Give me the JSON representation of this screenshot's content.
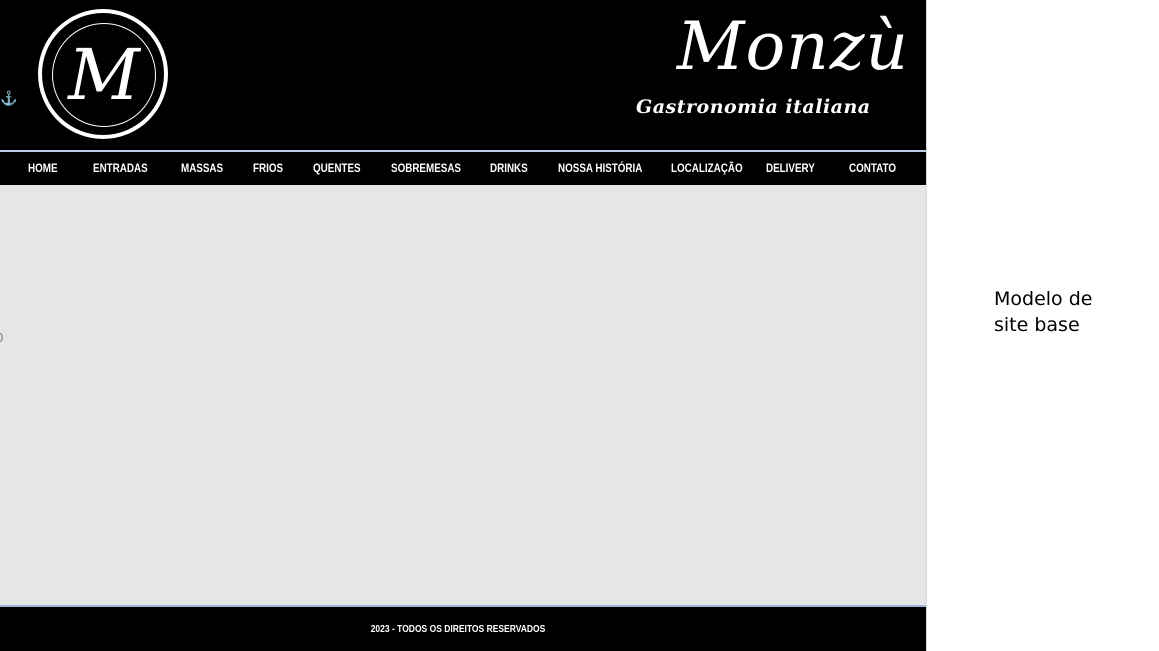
{
  "header": {
    "logo_letter": "M",
    "brand_name": "Monzù",
    "brand_tagline": "Gastronomia italiana"
  },
  "nav": {
    "items": [
      {
        "label": "HOME"
      },
      {
        "label": "ENTRADAS"
      },
      {
        "label": "MASSAS"
      },
      {
        "label": "FRIOS"
      },
      {
        "label": "QUENTES"
      },
      {
        "label": "SOBREMESAS"
      },
      {
        "label": "DRINKS"
      },
      {
        "label": "NOSSA HISTÓRIA"
      },
      {
        "label": "LOCALIZAÇÃO"
      },
      {
        "label": "DELIVERY"
      },
      {
        "label": "CONTATO"
      }
    ]
  },
  "content": {
    "edge_char": "0"
  },
  "footer": {
    "text": "2023 - TODOS OS DIREITOS RESERVADOS"
  },
  "side_note": {
    "line1": "Modelo de",
    "line2": "site base"
  },
  "colors": {
    "header_bg": "#000000",
    "content_bg": "#e6e6e6",
    "accent_line": "#b9cbe6",
    "anchor_icon": "#6a8fd0"
  },
  "icons": [
    "anchor-icon"
  ]
}
